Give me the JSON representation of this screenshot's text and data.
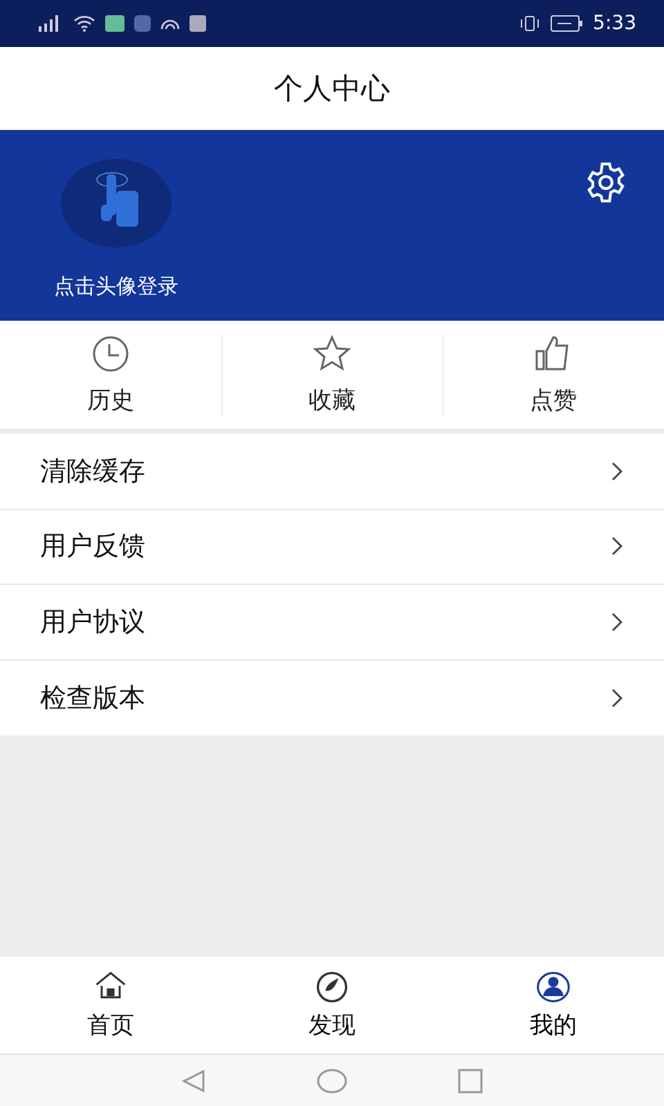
{
  "status_bar": {
    "time": "5:33"
  },
  "header": {
    "title": "个人中心"
  },
  "profile": {
    "login_hint": "点击头像登录"
  },
  "quick_actions": [
    {
      "kind": "history",
      "label": "历史"
    },
    {
      "kind": "favorite",
      "label": "收藏"
    },
    {
      "kind": "like",
      "label": "点赞"
    }
  ],
  "menu": [
    {
      "label": "清除缓存"
    },
    {
      "label": "用户反馈"
    },
    {
      "label": "用户协议"
    },
    {
      "label": "检查版本"
    }
  ],
  "tab_bar": [
    {
      "kind": "home",
      "label": "首页",
      "selected": false
    },
    {
      "kind": "discover",
      "label": "发现",
      "selected": false
    },
    {
      "kind": "me",
      "label": "我的",
      "selected": true
    }
  ]
}
